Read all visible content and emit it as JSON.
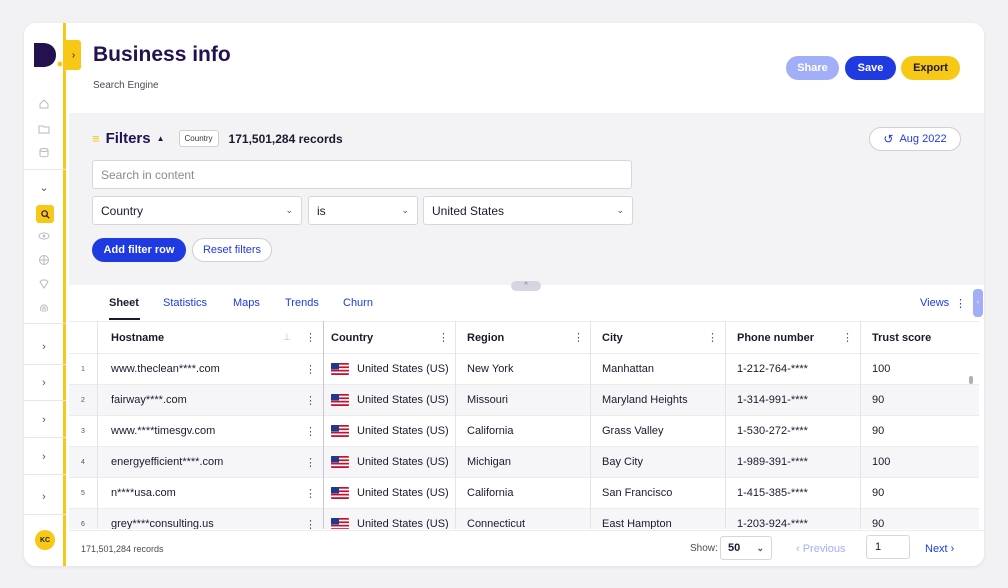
{
  "header": {
    "title": "Business info",
    "subtitle": "Search Engine",
    "share_label": "Share",
    "save_label": "Save",
    "export_label": "Export"
  },
  "sidebar": {
    "avatar_initials": "KC"
  },
  "filters": {
    "title": "Filters",
    "chip": "Country",
    "records": "171,501,284 records",
    "date_label": "Aug 2022",
    "search_placeholder": "Search in content",
    "field": "Country",
    "operator": "is",
    "value": "United States",
    "add_row_label": "Add filter row",
    "reset_label": "Reset filters"
  },
  "tabs": {
    "items": [
      "Sheet",
      "Statistics",
      "Maps",
      "Trends",
      "Churn"
    ],
    "active": "Sheet",
    "views_label": "Views"
  },
  "table": {
    "columns": [
      "Hostname",
      "Country",
      "Region",
      "City",
      "Phone number",
      "Trust score"
    ],
    "rows": [
      {
        "num": "1",
        "hostname": "www.theclean****.com",
        "country": "United States (US)",
        "region": "New York",
        "city": "Manhattan",
        "phone": "1-212-764-****",
        "trust": "100"
      },
      {
        "num": "2",
        "hostname": "fairway****.com",
        "country": "United States (US)",
        "region": "Missouri",
        "city": "Maryland Heights",
        "phone": "1-314-991-****",
        "trust": "90"
      },
      {
        "num": "3",
        "hostname": "www.****timesgv.com",
        "country": "United States (US)",
        "region": "California",
        "city": "Grass Valley",
        "phone": "1-530-272-****",
        "trust": "90"
      },
      {
        "num": "4",
        "hostname": "energyefficient****.com",
        "country": "United States (US)",
        "region": "Michigan",
        "city": "Bay City",
        "phone": "1-989-391-****",
        "trust": "100"
      },
      {
        "num": "5",
        "hostname": "n****usa.com",
        "country": "United States (US)",
        "region": "California",
        "city": "San Francisco",
        "phone": "1-415-385-****",
        "trust": "90"
      },
      {
        "num": "6",
        "hostname": "grey****consulting.us",
        "country": "United States (US)",
        "region": "Connecticut",
        "city": "East Hampton",
        "phone": "1-203-924-****",
        "trust": "90"
      }
    ]
  },
  "footer": {
    "records": "171,501,284 records",
    "show_label": "Show:",
    "page_size": "50",
    "prev_label": "‹ Previous",
    "page": "1",
    "next_label": "Next ›"
  },
  "colors": {
    "accent_yellow": "#f7c815",
    "primary_blue": "#1f3ae0",
    "title_navy": "#23124f"
  }
}
